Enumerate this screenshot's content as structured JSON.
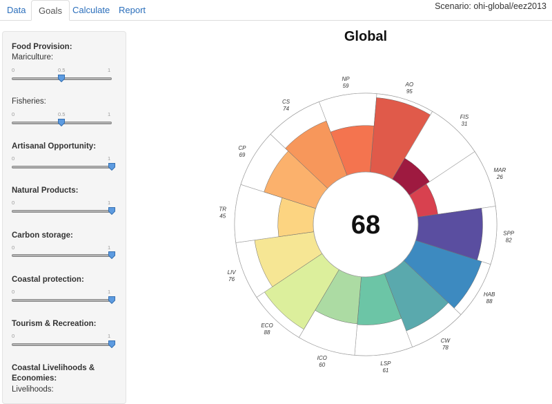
{
  "tabs": [
    "Data",
    "Goals",
    "Calculate",
    "Report"
  ],
  "active_tab": "Goals",
  "scenario_text": "Scenario: ohi-global/eez2013",
  "sidebar": {
    "groups": [
      {
        "title": "Food Provision:",
        "sliders": [
          {
            "label": "Mariculture:",
            "min": "0",
            "mid": "0.5",
            "max": "1",
            "value": 0.5
          },
          {
            "label": "Fisheries:",
            "min": "0",
            "mid": "0.5",
            "max": "1",
            "value": 0.5
          }
        ]
      },
      {
        "title": "Artisanal Opportunity:",
        "sliders": [
          {
            "min": "0",
            "max": "1",
            "value": 1
          }
        ]
      },
      {
        "title": "Natural Products:",
        "sliders": [
          {
            "min": "0",
            "max": "1",
            "value": 1
          }
        ]
      },
      {
        "title": "Carbon storage:",
        "sliders": [
          {
            "min": "0",
            "max": "1",
            "value": 1
          }
        ]
      },
      {
        "title": "Coastal protection:",
        "sliders": [
          {
            "min": "0",
            "max": "1",
            "value": 1
          }
        ]
      },
      {
        "title": "Tourism & Recreation:",
        "sliders": [
          {
            "min": "0",
            "max": "1",
            "value": 1
          }
        ]
      },
      {
        "title": "Coastal Livelihoods & Economies:",
        "sliders": [
          {
            "label": "Livelihoods:"
          }
        ]
      }
    ]
  },
  "chart_data": {
    "type": "flower",
    "title": "Global",
    "center_score": "68",
    "max": 100,
    "petals": [
      {
        "name": "NP",
        "value": 59,
        "color": "#f4744f"
      },
      {
        "name": "AO",
        "value": 95,
        "color": "#e05a4a"
      },
      {
        "name": "FIS",
        "value": 31,
        "color": "#9e1a40"
      },
      {
        "name": "MAR",
        "value": 26,
        "color": "#d8414f"
      },
      {
        "name": "SPP",
        "value": 82,
        "color": "#5a4ea0"
      },
      {
        "name": "HAB",
        "value": 88,
        "color": "#3d8ac0"
      },
      {
        "name": "CW",
        "value": 78,
        "color": "#5aa9ad"
      },
      {
        "name": "LSP",
        "value": 61,
        "color": "#6cc5a6"
      },
      {
        "name": "ICO",
        "value": 60,
        "color": "#acdba3"
      },
      {
        "name": "ECO",
        "value": 88,
        "color": "#dcef9c"
      },
      {
        "name": "LIV",
        "value": 76,
        "color": "#f6e694"
      },
      {
        "name": "TR",
        "value": 45,
        "color": "#fcd481"
      },
      {
        "name": "CP",
        "value": 69,
        "color": "#fbb16c"
      },
      {
        "name": "CS",
        "value": 74,
        "color": "#f7975b"
      }
    ]
  }
}
